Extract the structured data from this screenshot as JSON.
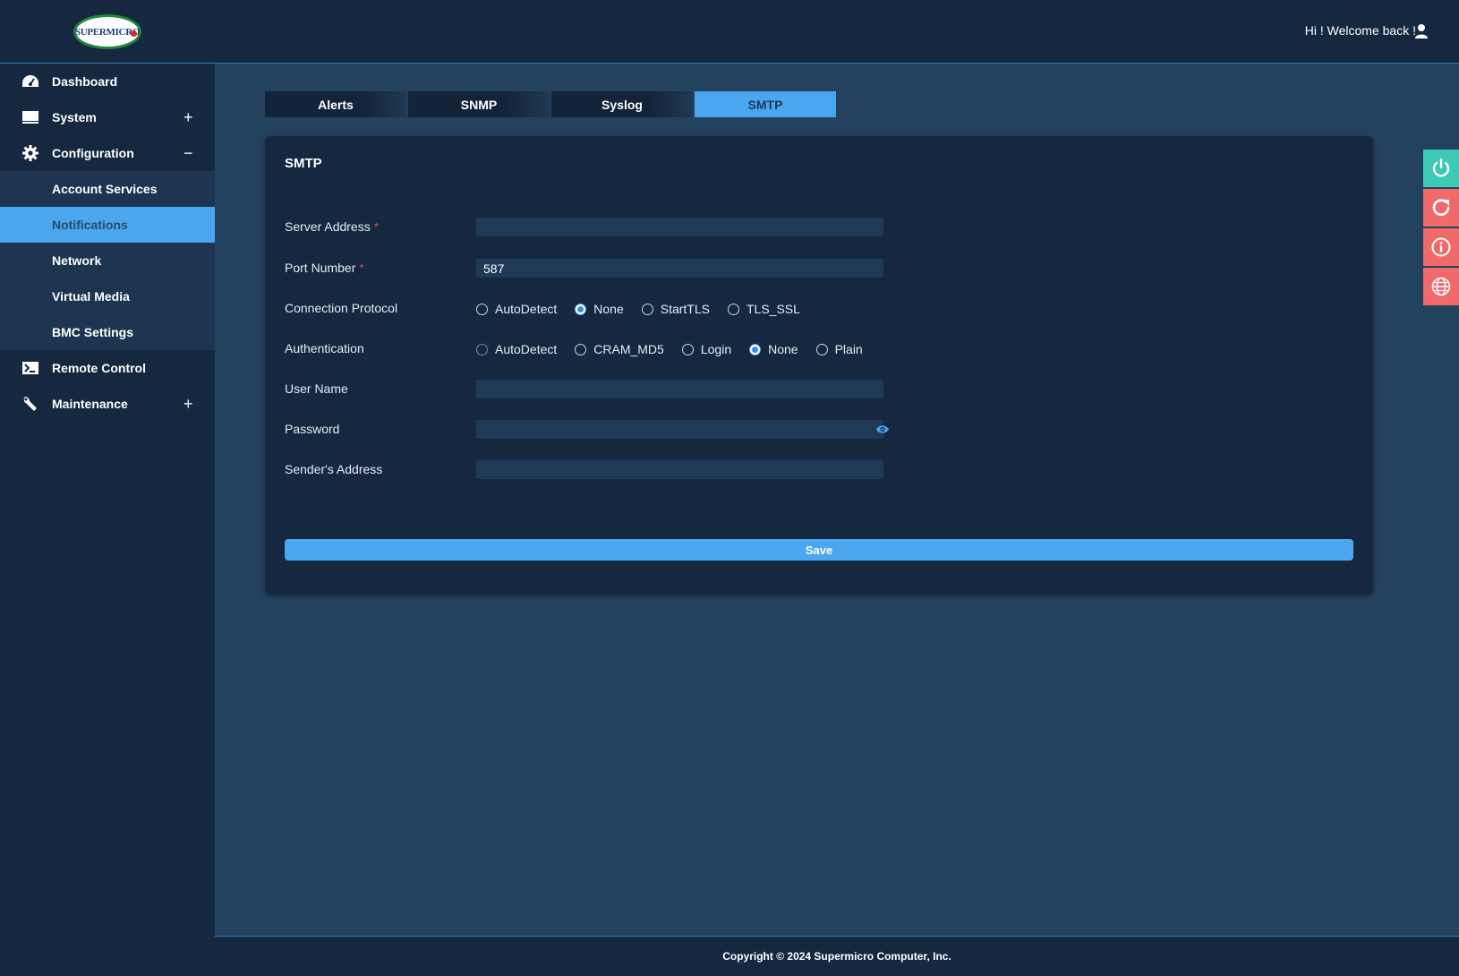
{
  "header": {
    "logo_text": "SUPERMICRO",
    "welcome": "Hi ! Welcome back !"
  },
  "sidebar": {
    "items": [
      {
        "label": "Dashboard",
        "icon": "dashboard-gauge-icon",
        "toggle": ""
      },
      {
        "label": "System",
        "icon": "monitor-icon",
        "toggle": "+"
      },
      {
        "label": "Configuration",
        "icon": "gear-icon",
        "toggle": "−"
      }
    ],
    "sub_items": [
      "Account Services",
      "Notifications",
      "Network",
      "Virtual Media",
      "BMC Settings"
    ],
    "active_sub_item": "Notifications",
    "items_after": [
      {
        "label": "Remote Control",
        "icon": "terminal-icon",
        "toggle": ""
      },
      {
        "label": "Maintenance",
        "icon": "wrench-icon",
        "toggle": "+"
      }
    ]
  },
  "tabs": [
    "Alerts",
    "SNMP",
    "Syslog",
    "SMTP"
  ],
  "active_tab": "SMTP",
  "panel": {
    "title": "SMTP",
    "fields": {
      "server_address": {
        "label": "Server Address",
        "required": "*",
        "value": ""
      },
      "port_number": {
        "label": "Port Number",
        "required": "*",
        "value": "587"
      },
      "connection_protocol": {
        "label": "Connection Protocol",
        "options": [
          "AutoDetect",
          "None",
          "StartTLS",
          "TLS_SSL"
        ],
        "selected": "None"
      },
      "authentication": {
        "label": "Authentication",
        "options": [
          "AutoDetect",
          "CRAM_MD5",
          "Login",
          "None",
          "Plain"
        ],
        "selected": "None"
      },
      "user_name": {
        "label": "User Name",
        "value": ""
      },
      "password": {
        "label": "Password",
        "value": ""
      },
      "sender_address": {
        "label": "Sender's Address",
        "value": ""
      }
    },
    "save_label": "Save"
  },
  "quick_actions": [
    "power-icon",
    "refresh-icon",
    "info-icon",
    "globe-icon"
  ],
  "colors": {
    "accent": "#4aa6ee",
    "sidebar_bg": "#152840",
    "content_bg": "#23425f",
    "power_btn": "#3cc9b6",
    "action_btn": "#f06a6a",
    "required": "#e2403f"
  },
  "footer": {
    "copyright": "Copyright © 2024 Supermicro Computer, Inc."
  }
}
